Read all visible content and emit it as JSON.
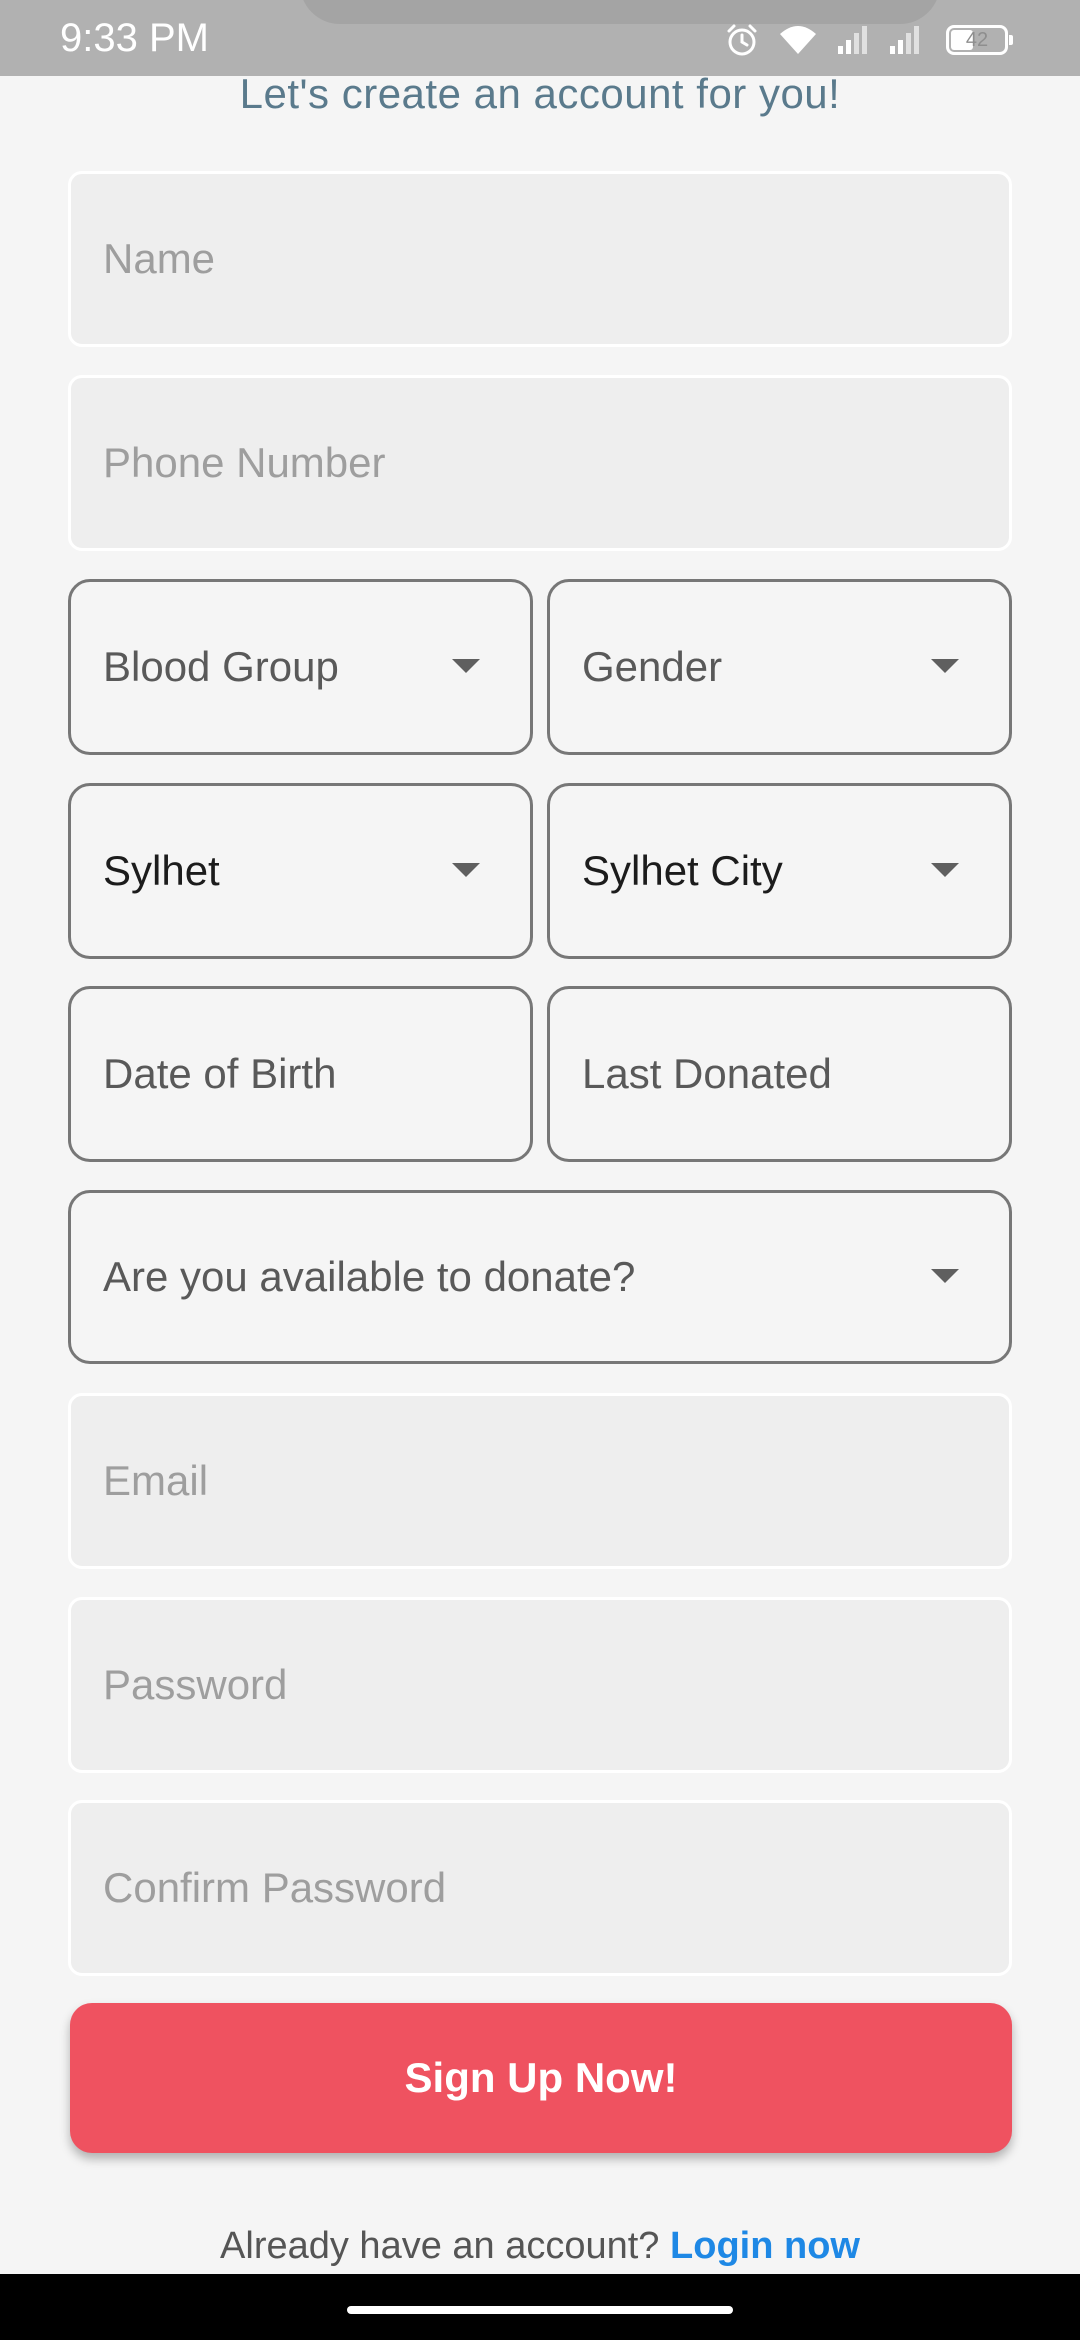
{
  "status_bar": {
    "time": "9:33 PM",
    "battery_level": "42",
    "icons": [
      "alarm-icon",
      "wifi-icon",
      "signal-icon",
      "signal-icon",
      "battery-icon"
    ]
  },
  "subtitle": "Let's create an account for you!",
  "form": {
    "name_placeholder": "Name",
    "phone_placeholder": "Phone Number",
    "blood_group_label": "Blood Group",
    "gender_label": "Gender",
    "division_value": "Sylhet",
    "city_value": "Sylhet City",
    "dob_label": "Date of Birth",
    "last_donated_label": "Last Donated",
    "availability_label": "Are you available to donate?",
    "email_placeholder": "Email",
    "password_placeholder": "Password",
    "confirm_password_placeholder": "Confirm Password"
  },
  "signup_button": "Sign Up Now!",
  "login_prompt": {
    "text": "Already have an account? ",
    "link": "Login now"
  },
  "colors": {
    "primary": "#ef5260",
    "link": "#1e88e5",
    "subtitle": "#5a7a8c"
  }
}
